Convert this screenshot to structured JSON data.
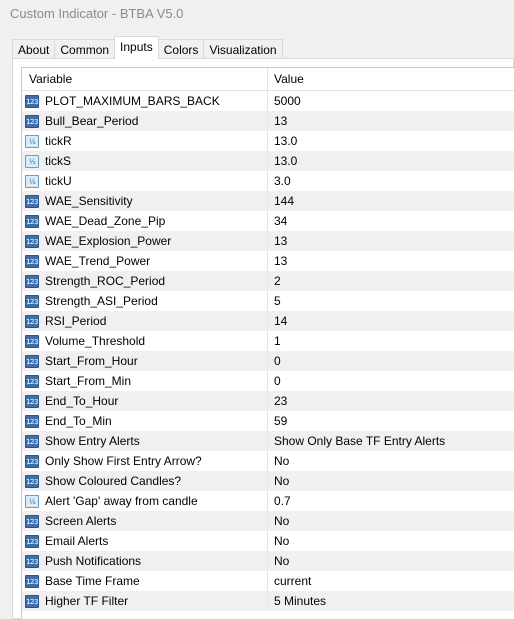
{
  "window": {
    "title": "Custom Indicator - BTBA V5.0"
  },
  "tabs": [
    {
      "label": "About"
    },
    {
      "label": "Common"
    },
    {
      "label": "Inputs",
      "active": true
    },
    {
      "label": "Colors"
    },
    {
      "label": "Visualization"
    }
  ],
  "table": {
    "headers": {
      "variable": "Variable",
      "value": "Value"
    },
    "icon_types": {
      "int": "integer-type-icon",
      "dbl": "double-type-icon"
    },
    "rows": [
      {
        "type": "int",
        "variable": "PLOT_MAXIMUM_BARS_BACK",
        "value": "5000"
      },
      {
        "type": "int",
        "variable": "Bull_Bear_Period",
        "value": "13"
      },
      {
        "type": "dbl",
        "variable": "tickR",
        "value": "13.0"
      },
      {
        "type": "dbl",
        "variable": "tickS",
        "value": "13.0"
      },
      {
        "type": "dbl",
        "variable": "tickU",
        "value": "3.0"
      },
      {
        "type": "int",
        "variable": "WAE_Sensitivity",
        "value": "144"
      },
      {
        "type": "int",
        "variable": "WAE_Dead_Zone_Pip",
        "value": "34"
      },
      {
        "type": "int",
        "variable": "WAE_Explosion_Power",
        "value": "13"
      },
      {
        "type": "int",
        "variable": "WAE_Trend_Power",
        "value": "13"
      },
      {
        "type": "int",
        "variable": "Strength_ROC_Period",
        "value": "2"
      },
      {
        "type": "int",
        "variable": "Strength_ASI_Period",
        "value": "5"
      },
      {
        "type": "int",
        "variable": "RSI_Period",
        "value": "14"
      },
      {
        "type": "int",
        "variable": "Volume_Threshold",
        "value": "1"
      },
      {
        "type": "int",
        "variable": "Start_From_Hour",
        "value": "0"
      },
      {
        "type": "int",
        "variable": "Start_From_Min",
        "value": "0"
      },
      {
        "type": "int",
        "variable": "End_To_Hour",
        "value": "23"
      },
      {
        "type": "int",
        "variable": "End_To_Min",
        "value": "59"
      },
      {
        "type": "int",
        "variable": "Show Entry Alerts",
        "value": "Show Only Base TF Entry Alerts"
      },
      {
        "type": "int",
        "variable": "Only Show First Entry Arrow?",
        "value": "No"
      },
      {
        "type": "int",
        "variable": "Show Coloured Candles?",
        "value": "No"
      },
      {
        "type": "dbl",
        "variable": "Alert 'Gap' away from candle",
        "value": "0.7"
      },
      {
        "type": "int",
        "variable": "Screen Alerts",
        "value": "No"
      },
      {
        "type": "int",
        "variable": "Email Alerts",
        "value": "No"
      },
      {
        "type": "int",
        "variable": "Push Notifications",
        "value": "No"
      },
      {
        "type": "int",
        "variable": "Base Time Frame",
        "value": "current"
      },
      {
        "type": "int",
        "variable": "Higher TF Filter",
        "value": "5 Minutes"
      }
    ]
  }
}
